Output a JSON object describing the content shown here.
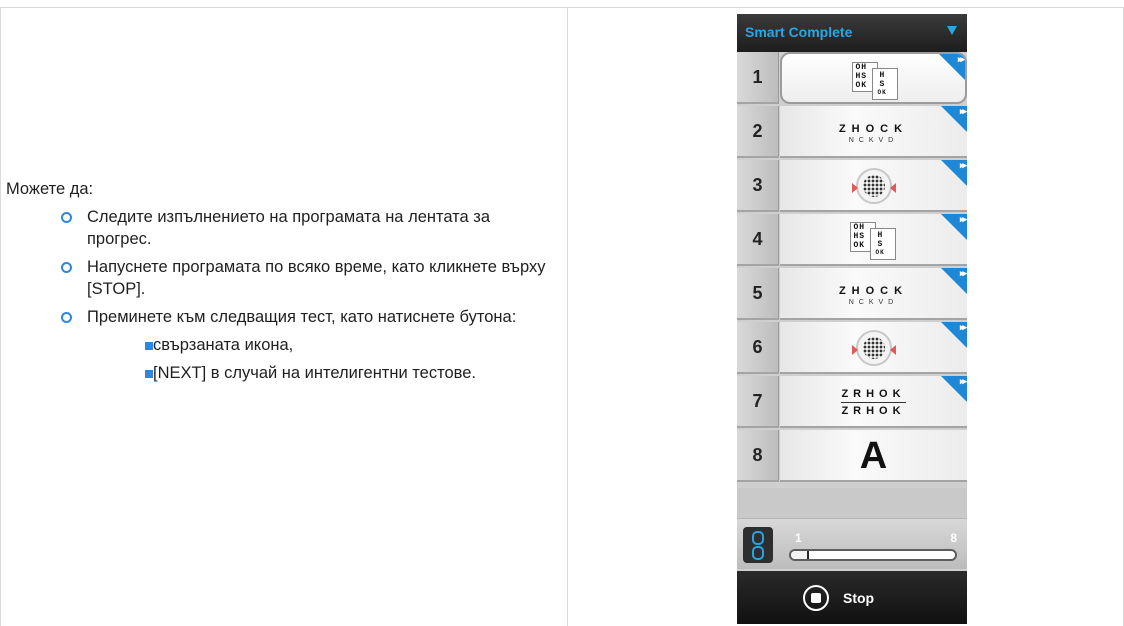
{
  "instructions": {
    "intro": "Можете да:",
    "items": [
      "Следите изпълнението на програмата на лентата за прогрес.",
      "Напуснете програмата по всяко време, като кликнете върху [STOP].",
      "Преминете към следващия тест, като натиснете бутона:"
    ],
    "subitems": [
      "свързаната икона,",
      "[NEXT] в случай на интелигентни тестове."
    ]
  },
  "program": {
    "dropdown_label": "Smart Complete",
    "tests": [
      {
        "number": "1",
        "icon": "eye-chart-icon",
        "active": true,
        "has_skip": true
      },
      {
        "number": "2",
        "icon": "acuity-letters-icon",
        "active": false,
        "has_skip": true
      },
      {
        "number": "3",
        "icon": "dot-target-icon",
        "active": false,
        "has_skip": true
      },
      {
        "number": "4",
        "icon": "eye-chart-icon",
        "active": false,
        "has_skip": true
      },
      {
        "number": "5",
        "icon": "acuity-letters-icon",
        "active": false,
        "has_skip": true
      },
      {
        "number": "6",
        "icon": "dot-target-icon",
        "active": false,
        "has_skip": true
      },
      {
        "number": "7",
        "icon": "split-letters-icon",
        "active": false,
        "has_skip": true
      },
      {
        "number": "8",
        "icon": "big-letter-icon",
        "active": false,
        "has_skip": false
      }
    ],
    "glyphs": {
      "chart_lines": [
        "OH",
        "HS",
        "OK",
        "H",
        "S",
        "OK"
      ],
      "acuity_big": "ZHOCK",
      "acuity_small": "NCKVD",
      "split_top": "ZRHOK",
      "split_bottom": "ZRHOK",
      "big_letter": "A",
      "skip_glyph": "▸▸"
    },
    "progress": {
      "start": "1",
      "end": "8",
      "value": 0.1
    },
    "stop_label": "Stop"
  },
  "colors": {
    "accent": "#2aa6e6",
    "corner": "#1e88d6",
    "bullet": "#2e86de"
  }
}
